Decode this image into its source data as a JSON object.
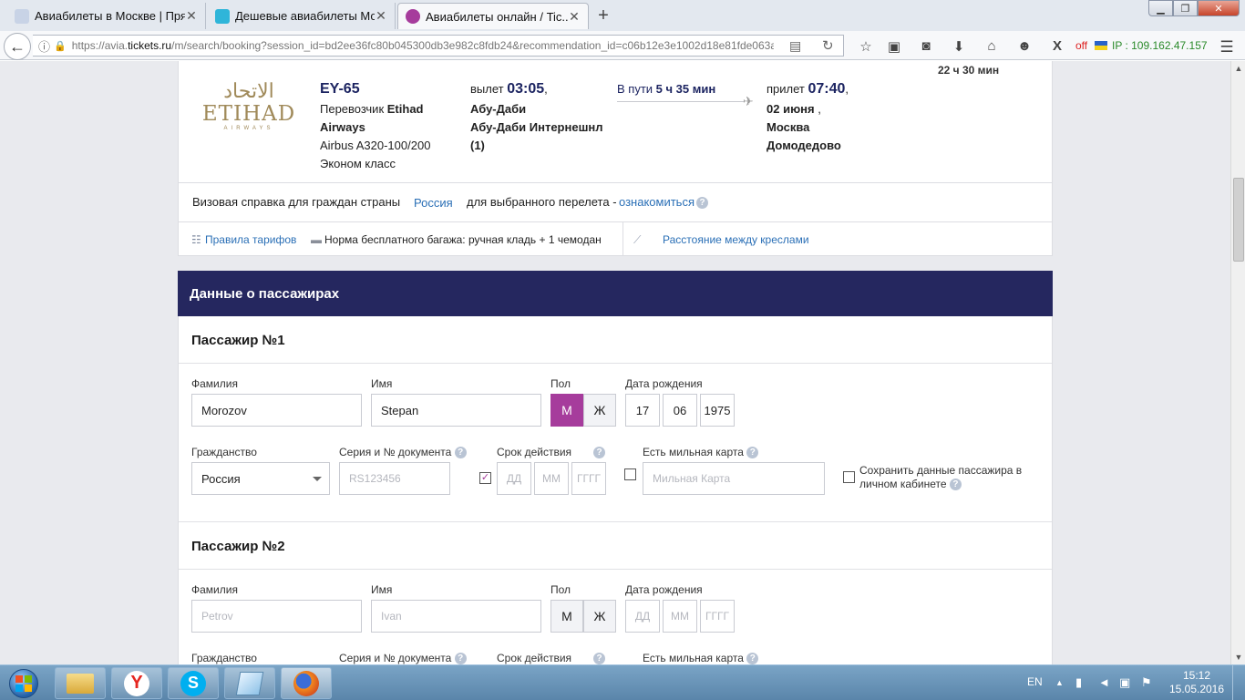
{
  "browser": {
    "tabs": [
      {
        "title": "Авиабилеты в Москве | Прям..."
      },
      {
        "title": "Дешевые авиабилеты Мо..."
      },
      {
        "title": "Авиабилеты онлайн / Tic..."
      }
    ],
    "url_prefix": "https://avia.",
    "url_domain": "tickets.ru",
    "url_rest": "/m/search/booking?session_id=bd2ee36fc80b045300db3e982c8fdb24&recommendation_id=c06b12e3e1002d18e81fde063a",
    "off_label": "off",
    "ip_label": "IP : 109.162.47.157"
  },
  "flight": {
    "duration_top": "22 ч 30 мин",
    "logo_arabic": "الاتحاد",
    "logo_latin": "ETIHAD",
    "logo_sub": "AIRWAYS",
    "flight_number": "EY-65",
    "carrier_label": "Перевозчик",
    "carrier_name_1": "Etihad",
    "carrier_name_2": "Airways",
    "aircraft": "Airbus A320-100/200",
    "cabin": "Эконом класс",
    "departure_label": "вылет",
    "departure_time": "03:05",
    "departure_city": "Абу-Даби",
    "departure_airport": "Абу-Даби Интернешнл",
    "departure_terminal": "(1)",
    "travel_label": "В пути",
    "travel_time": "5 ч 35 мин",
    "arrival_label": "прилет",
    "arrival_time": "07:40",
    "arrival_date": "02 июня",
    "arrival_city": "Москва",
    "arrival_airport": "Домодедово"
  },
  "visa": {
    "text_1": "Визовая справка для граждан страны",
    "country": "Россия",
    "text_2": "для выбранного перелета -",
    "link": "ознакомиться"
  },
  "rules": {
    "fare_rules": "Правила тарифов",
    "baggage": "Норма бесплатного багажа: ручная кладь + 1 чемодан",
    "seat_distance": "Расстояние между креслами"
  },
  "passengers": {
    "header": "Данные о пассажирах",
    "labels": {
      "surname": "Фамилия",
      "name": "Имя",
      "gender": "Пол",
      "birthdate": "Дата рождения",
      "citizenship": "Гражданство",
      "document": "Серия и № документа",
      "validity": "Срок действия",
      "mileage": "Есть мильная карта",
      "save": "Сохранить данные пассажира в личном кабинете"
    },
    "p1": {
      "title": "Пассажир №1",
      "surname": "Morozov",
      "name": "Stepan",
      "gender_m": "М",
      "gender_f": "Ж",
      "day": "17",
      "month": "06",
      "year": "1975",
      "citizenship": "Россия",
      "document_ph": "RS123456",
      "dd_ph": "ДД",
      "mm_ph": "ММ",
      "yyyy_ph": "ГГГГ",
      "mileage_ph": "Мильная Карта"
    },
    "p2": {
      "title": "Пассажир №2",
      "surname_ph": "Petrov",
      "name_ph": "Ivan",
      "gender_m": "М",
      "gender_f": "Ж",
      "dd_ph": "ДД",
      "mm_ph": "ММ",
      "yyyy_ph": "ГГГГ"
    }
  },
  "taskbar": {
    "lang": "EN",
    "time": "15:12",
    "date": "15.05.2016"
  }
}
